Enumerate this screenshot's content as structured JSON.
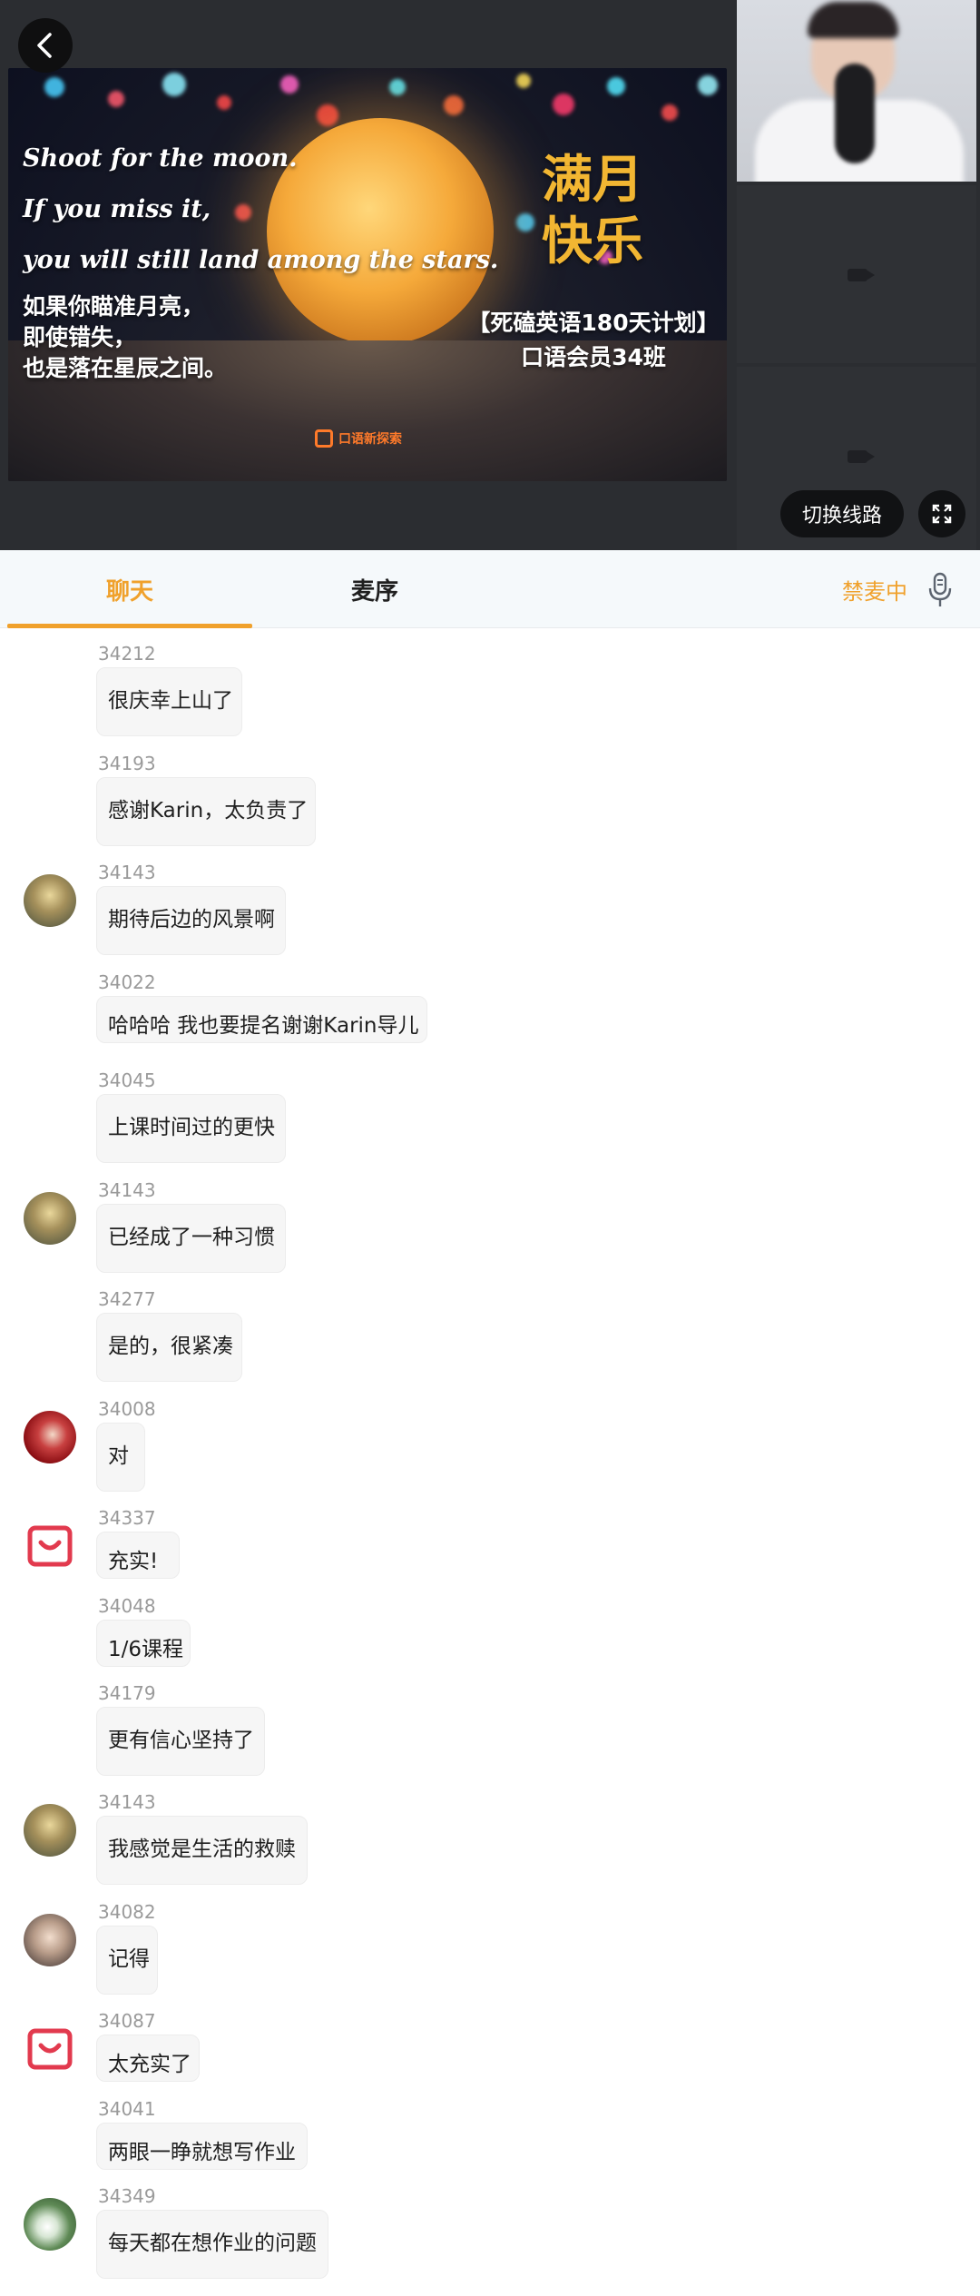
{
  "video": {
    "slide": {
      "en_lines": [
        "Shoot for the moon.",
        "If you miss it,",
        "you will still land among the stars."
      ],
      "cn_lines": [
        "如果你瞄准月亮，",
        "即使错失，",
        "也是落在星辰之间。"
      ],
      "title_lines": [
        "满月",
        "快乐"
      ],
      "plan_lines": [
        "【死磕英语180天计划】",
        "口语会员34班"
      ],
      "logo_text": "口语新探索"
    },
    "switch_line_label": "切换线路",
    "fullscreen_icon": "fullscreen-icon",
    "back_icon": "back-arrow-icon"
  },
  "tabs": {
    "chat": "聊天",
    "mic_queue": "麦序",
    "mute_status": "禁麦中",
    "mic_icon": "microphone-icon",
    "active_color": "#f0a12c"
  },
  "messages": [
    {
      "uid": "34212",
      "text": "很庆幸上山了",
      "avatar": "none"
    },
    {
      "uid": "34193",
      "text": "感谢Karin，太负责了",
      "avatar": "none"
    },
    {
      "uid": "34143",
      "text": "期待后边的风景啊",
      "avatar": "photo"
    },
    {
      "uid": "34022",
      "text": "哈哈哈 我也要提名谢谢Karin导儿",
      "avatar": "none"
    },
    {
      "uid": "34045",
      "text": "上课时间过的更快",
      "avatar": "none"
    },
    {
      "uid": "34143",
      "text": "已经成了一种习惯",
      "avatar": "photo"
    },
    {
      "uid": "34277",
      "text": "是的，很紧凑",
      "avatar": "none"
    },
    {
      "uid": "34008",
      "text": "对",
      "avatar": "photo"
    },
    {
      "uid": "34337",
      "text": "充实!",
      "avatar": "logo"
    },
    {
      "uid": "34048",
      "text": "1/6课程",
      "avatar": "none"
    },
    {
      "uid": "34179",
      "text": "更有信心坚持了",
      "avatar": "none"
    },
    {
      "uid": "34143",
      "text": "我感觉是生活的救赎",
      "avatar": "photo"
    },
    {
      "uid": "34082",
      "text": "记得",
      "avatar": "photo"
    },
    {
      "uid": "34087",
      "text": "太充实了",
      "avatar": "logo"
    },
    {
      "uid": "34041",
      "text": "两眼一睁就想写作业",
      "avatar": "none"
    },
    {
      "uid": "34349",
      "text": "每天都在想作业的问题",
      "avatar": "photo"
    }
  ]
}
